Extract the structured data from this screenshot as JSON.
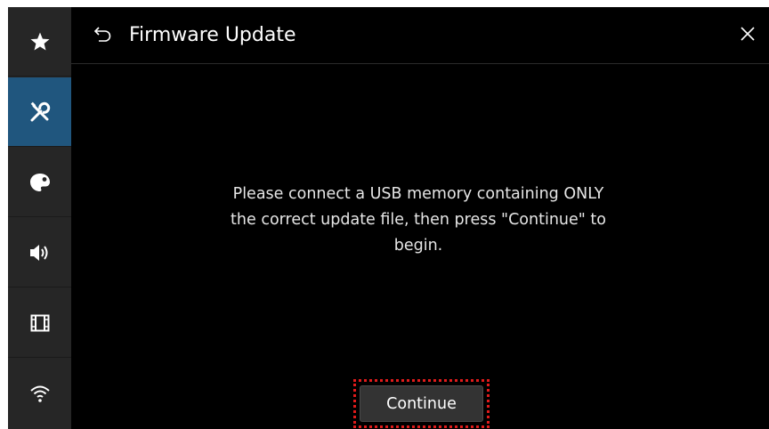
{
  "header": {
    "title": "Firmware Update"
  },
  "sidebar": {
    "items": [
      {
        "icon": "star-icon",
        "active": false
      },
      {
        "icon": "tools-icon",
        "active": true
      },
      {
        "icon": "palette-icon",
        "active": false
      },
      {
        "icon": "speaker-icon",
        "active": false
      },
      {
        "icon": "film-icon",
        "active": false
      },
      {
        "icon": "wifi-icon",
        "active": false
      }
    ]
  },
  "main": {
    "message": "Please connect a USB memory containing  ONLY\nthe correct update file, then press \"Continue\" to\nbegin.",
    "continue_label": "Continue"
  },
  "colors": {
    "sidebar_bg": "#262626",
    "sidebar_active": "#20567e",
    "screen_bg": "#000000",
    "highlight": "#e01b1b",
    "button_bg": "#333333"
  }
}
